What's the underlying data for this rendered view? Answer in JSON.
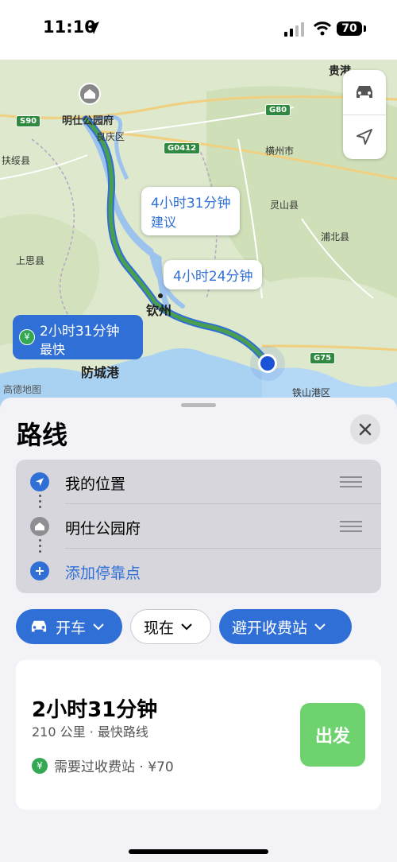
{
  "status_bar": {
    "time": "11:10",
    "battery": "70"
  },
  "map": {
    "labels": {
      "guigang": "贵港",
      "hengzhou": "横州市",
      "lingshan": "灵山县",
      "pubei": "浦北县",
      "fusui": "扶绥县",
      "shangsi": "上思县",
      "liangqing": "良庆区",
      "qinzhou": "钦州",
      "fangchenggang": "防城港",
      "tieshangang": "铁山港区",
      "destination": "明仕公园府",
      "map_provider": "高德地图"
    },
    "road_shields": {
      "s90": "S90",
      "g80": "G80",
      "g0412": "G0412",
      "g75": "G75"
    },
    "callouts": {
      "suggested_time": "4小时31分钟",
      "suggested_label": "建议",
      "alt_time": "4小时24分钟",
      "fast_time": "2小时31分钟",
      "fast_label": "最快",
      "yen_symbol": "¥"
    }
  },
  "sheet": {
    "title": "路线",
    "waypoints": [
      {
        "label": "我的位置",
        "icon": "location-arrow-icon"
      },
      {
        "label": "明仕公园府",
        "icon": "house-icon"
      },
      {
        "label": "添加停靠点",
        "icon": "plus-icon"
      }
    ],
    "chips": {
      "drive": "开车",
      "time": "现在",
      "avoid": "避开收费站"
    },
    "route": {
      "duration": "2小时31分钟",
      "details": "210 公里 · 最快路线",
      "toll_text": "需要过收费站 · ¥70",
      "yen_symbol": "¥",
      "go_label": "出发"
    }
  },
  "colors": {
    "accent_blue": "#2f6fd6",
    "route_green": "#4a9f4f",
    "go_green": "#6ed36e",
    "toll_green": "#34a853"
  }
}
